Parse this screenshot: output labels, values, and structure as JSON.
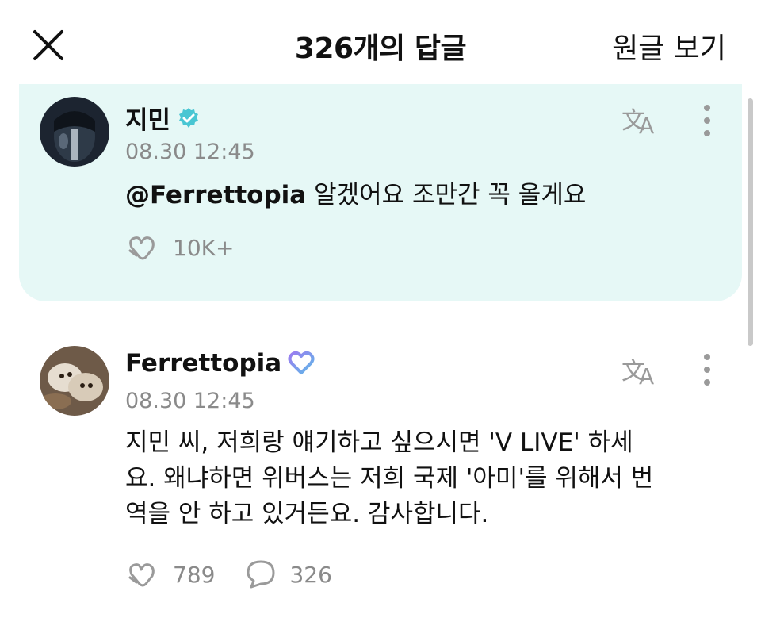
{
  "header": {
    "title": "326개의 답글",
    "view_original": "원글 보기",
    "close_icon": "close-icon"
  },
  "comments": [
    {
      "author": "지민",
      "badge": "verified-check-icon",
      "time": "08.30 12:45",
      "mention": "@Ferrettopia",
      "text": " 알겠어요 조만간 꼭 올게요",
      "likes": "10K+",
      "highlight_color": "#e6f8f6"
    },
    {
      "author": "Ferrettopia",
      "badge": "membership-heart-icon",
      "time": "08.30 12:45",
      "text_lines": [
        "지민 씨, 저희랑 얘기하고 싶으시면 'V LIVE' 하세",
        "요. 왜냐하면 위버스는 저희 국제 '아미'를 위해서 번",
        "역을 안 하고 있거든요. 감사합니다."
      ],
      "likes": "789",
      "replies": "326"
    }
  ],
  "colors": {
    "accent": "#5fc8c0",
    "verified": "#49c6d3",
    "icon_gray": "#9a9a9a"
  }
}
